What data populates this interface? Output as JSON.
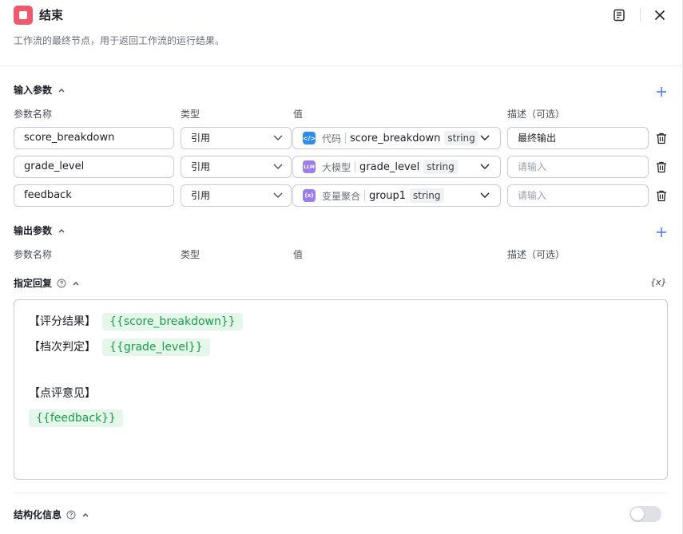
{
  "header": {
    "title": "结束",
    "description": "工作流的最终节点，用于返回工作流的运行结果。"
  },
  "input_params": {
    "title": "输入参数",
    "columns": {
      "name": "参数名称",
      "type": "类型",
      "value": "值",
      "desc": "描述（可选）"
    },
    "rows": [
      {
        "name": "score_breakdown",
        "type": "引用",
        "source": "代码",
        "var": "score_breakdown",
        "dtype": "string",
        "desc": "最终输出",
        "desc_placeholder": ""
      },
      {
        "name": "grade_level",
        "type": "引用",
        "source": "大模型",
        "var": "grade_level",
        "dtype": "string",
        "desc": "",
        "desc_placeholder": "请输入"
      },
      {
        "name": "feedback",
        "type": "引用",
        "source": "变量聚合",
        "var": "group1",
        "dtype": "string",
        "desc": "",
        "desc_placeholder": "请输入"
      }
    ]
  },
  "output_params": {
    "title": "输出参数",
    "columns": {
      "name": "参数名称",
      "type": "类型",
      "value": "值",
      "desc": "描述（可选）"
    }
  },
  "reply": {
    "title": "指定回复",
    "var_icon_label": "{x}",
    "lines": {
      "l1_label": "【评分结果】",
      "l1_var": "{{score_breakdown}}",
      "l2_label": "【档次判定】",
      "l2_var": "{{grade_level}}",
      "l3_label": "【点评意见】",
      "l4_var": "{{feedback}}"
    }
  },
  "structured": {
    "title": "结构化信息",
    "enabled": false
  },
  "icons": {
    "row1": "LLM-code-icon",
    "code_label": "</>",
    "llm_label": "LLM",
    "agg_label": "(x)"
  },
  "colors": {
    "end_node": "#f0586c",
    "accent": "#4d7cf7",
    "code_icon": "#2e8cf0",
    "llm_icon": "#9b7df0",
    "var_tag_bg": "#e5f6ea",
    "var_tag_text": "#19a04b"
  }
}
